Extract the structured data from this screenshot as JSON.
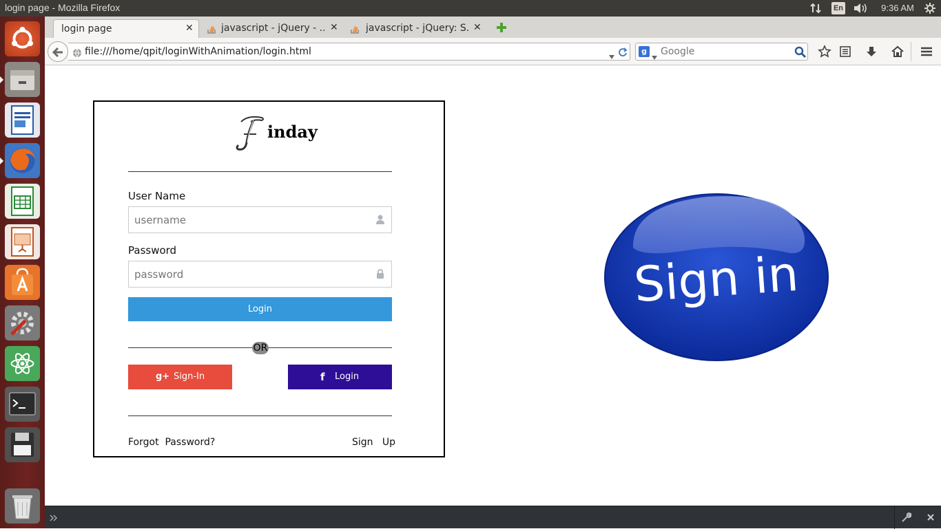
{
  "window": {
    "title": "login page - Mozilla Firefox"
  },
  "system_tray": {
    "keyboard_layout": "En",
    "time": "9:36 AM"
  },
  "launcher": {
    "items": [
      {
        "name": "ubuntu-dash-icon"
      },
      {
        "name": "files-icon"
      },
      {
        "name": "writer-icon"
      },
      {
        "name": "firefox-icon",
        "active": true
      },
      {
        "name": "calc-icon"
      },
      {
        "name": "impress-icon"
      },
      {
        "name": "software-center-icon"
      },
      {
        "name": "system-settings-icon"
      },
      {
        "name": "atom-editor-icon"
      },
      {
        "name": "terminal-icon"
      },
      {
        "name": "save-disk-icon"
      },
      {
        "name": "trash-icon"
      }
    ]
  },
  "browser": {
    "tabs": [
      {
        "label": "login page",
        "active": true
      },
      {
        "label": "javascript - jQuery - ..."
      },
      {
        "label": "javascript - jQuery: S..."
      }
    ],
    "url": "file:///home/qpit/loginWithAnimation/login.html",
    "search_placeholder": "Google"
  },
  "login_card": {
    "brand_letter": "F",
    "brand_text": "inday",
    "username_label": "User Name",
    "username_placeholder": "username",
    "password_label": "Password",
    "password_placeholder": "password",
    "login_button": "Login",
    "or_text": "OR",
    "google_button": "Sign-In",
    "facebook_button": "Login",
    "forgot_link": "Forgot  Password?",
    "signup_link": "Sign   Up"
  },
  "signin_art": {
    "text": "Sign in",
    "color": "#1a3fb5"
  },
  "colors": {
    "login_button": "#3498db",
    "google_button": "#e74c3c",
    "facebook_button": "#2e0e96"
  }
}
